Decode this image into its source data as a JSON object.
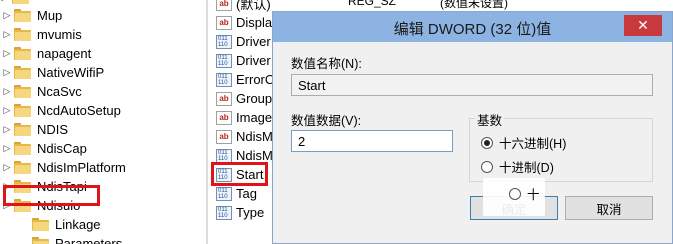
{
  "tree": {
    "items": [
      {
        "label": "Mup",
        "depth": 0,
        "selected": false
      },
      {
        "label": "mvumis",
        "depth": 0,
        "selected": false
      },
      {
        "label": "napagent",
        "depth": 0,
        "selected": false
      },
      {
        "label": "NativeWifiP",
        "depth": 0,
        "selected": false
      },
      {
        "label": "NcaSvc",
        "depth": 0,
        "selected": false
      },
      {
        "label": "NcdAutoSetup",
        "depth": 0,
        "selected": false
      },
      {
        "label": "NDIS",
        "depth": 0,
        "selected": false
      },
      {
        "label": "NdisCap",
        "depth": 0,
        "selected": false
      },
      {
        "label": "NdisImPlatform",
        "depth": 0,
        "selected": false
      },
      {
        "label": "NdisTapi",
        "depth": 0,
        "selected": false
      },
      {
        "label": "Ndisuio",
        "depth": 0,
        "selected": true
      },
      {
        "label": "Linkage",
        "depth": 1,
        "selected": false
      },
      {
        "label": "Parameters",
        "depth": 1,
        "selected": false
      }
    ]
  },
  "values": {
    "items": [
      {
        "name": "(默认)",
        "type": "REG_SZ",
        "data": "(数值未设置)",
        "icon": "string-value-icon"
      },
      {
        "name": "Displa",
        "icon": "string-value-icon"
      },
      {
        "name": "Driver",
        "icon": "binary-value-icon"
      },
      {
        "name": "Driver",
        "icon": "binary-value-icon"
      },
      {
        "name": "ErrorC",
        "icon": "binary-value-icon"
      },
      {
        "name": "Group",
        "icon": "string-value-icon"
      },
      {
        "name": "Image",
        "icon": "string-value-icon"
      },
      {
        "name": "NdisM",
        "icon": "string-value-icon"
      },
      {
        "name": "NdisM",
        "icon": "binary-value-icon"
      },
      {
        "name": "Start",
        "icon": "binary-value-icon"
      },
      {
        "name": "Tag",
        "icon": "binary-value-icon"
      },
      {
        "name": "Type",
        "icon": "binary-value-icon"
      }
    ]
  },
  "dialog": {
    "title": "编辑 DWORD (32 位)值",
    "close_label": "✕",
    "value_name_label": "数值名称(N):",
    "value_name": "Start",
    "value_data_label": "数值数据(V):",
    "value_data": "2",
    "base_label": "基数",
    "radix_options": [
      {
        "label": "十六进制(H)",
        "checked": true
      },
      {
        "label": "十进制(D)",
        "checked": false
      }
    ],
    "ok_label": "确定",
    "cancel_label": "取消",
    "fragment_text": "十"
  },
  "colors": {
    "title_bar": "#8db3e2",
    "close_button": "#c7393d",
    "annotation_red": "#e0131a",
    "folder": "#f6d77d"
  }
}
